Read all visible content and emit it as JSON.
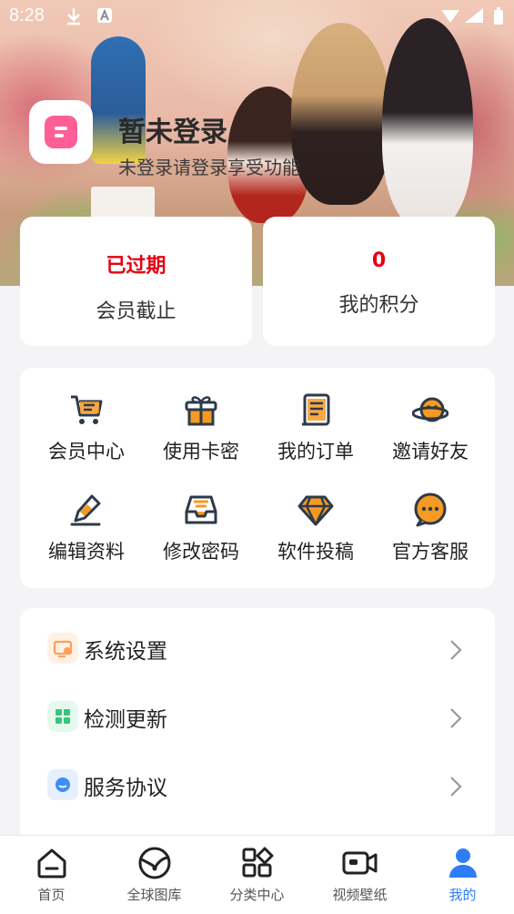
{
  "status_bar": {
    "time": "8:28"
  },
  "profile": {
    "title": "暂未登录",
    "subtitle": "未登录请登录享受功能"
  },
  "stats": [
    {
      "value": "已过期",
      "label": "会员截止"
    },
    {
      "value": "0",
      "label": "我的积分"
    }
  ],
  "grid": [
    {
      "label": "会员中心",
      "icon": "cart-icon"
    },
    {
      "label": "使用卡密",
      "icon": "gift-icon"
    },
    {
      "label": "我的订单",
      "icon": "order-icon"
    },
    {
      "label": "邀请好友",
      "icon": "invite-planet-icon"
    },
    {
      "label": "编辑资料",
      "icon": "pen-edit-icon"
    },
    {
      "label": "修改密码",
      "icon": "inbox-icon"
    },
    {
      "label": "软件投稿",
      "icon": "diamond-icon"
    },
    {
      "label": "官方客服",
      "icon": "chat-bubble-icon"
    }
  ],
  "list": [
    {
      "label": "系统设置",
      "icon": "settings-icon",
      "color": "#ff9f5a"
    },
    {
      "label": "检测更新",
      "icon": "update-grid-icon",
      "color": "#34c77b"
    },
    {
      "label": "服务协议",
      "icon": "agreement-chat-icon",
      "color": "#3d8ef5"
    }
  ],
  "nav": [
    {
      "label": "首页",
      "icon": "home-icon"
    },
    {
      "label": "全球图库",
      "icon": "globe-gallery-icon"
    },
    {
      "label": "分类中心",
      "icon": "category-icon"
    },
    {
      "label": "视频壁纸",
      "icon": "video-camera-icon"
    },
    {
      "label": "我的",
      "icon": "user-icon",
      "active": true
    }
  ],
  "colors": {
    "accent": "#2f7df6",
    "icon_dark": "#2d3a4a",
    "icon_orange": "#f59a23",
    "expired_red": "#e60012"
  }
}
